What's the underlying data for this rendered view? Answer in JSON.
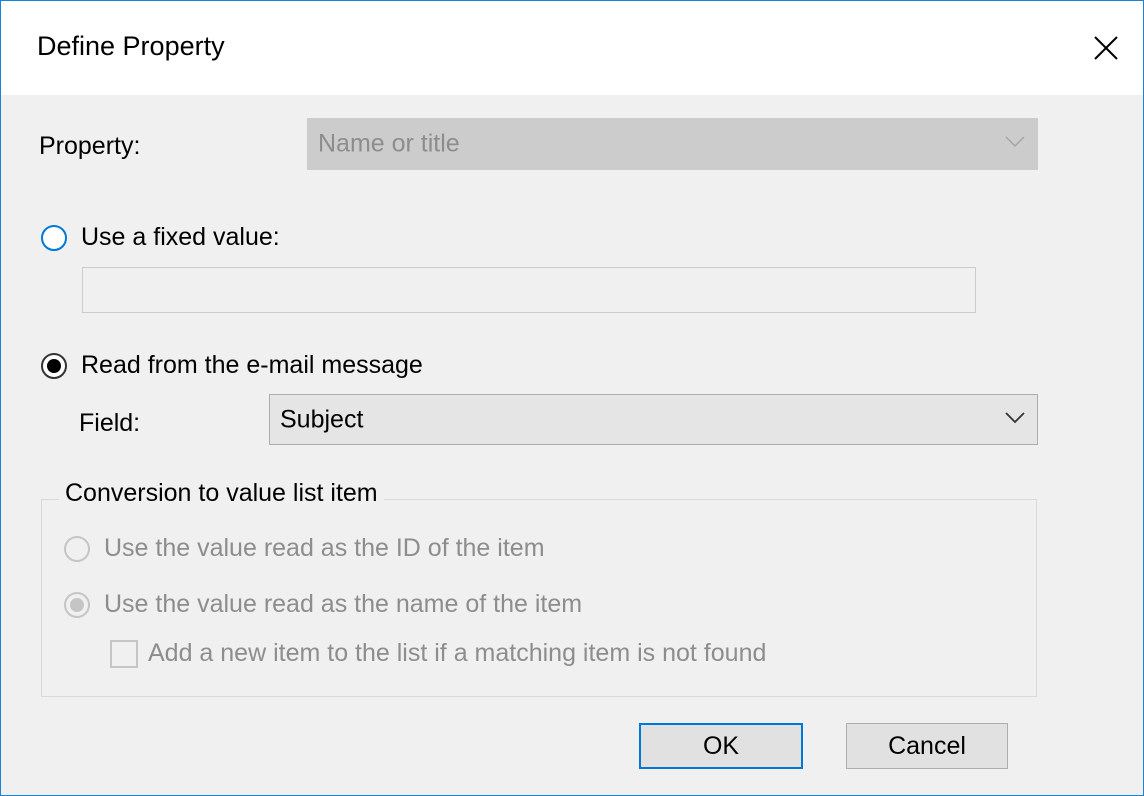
{
  "window": {
    "title": "Define Property",
    "close_icon": "close-icon"
  },
  "property": {
    "label": "Property:",
    "value": "Name or title"
  },
  "fixed_value": {
    "label": "Use a fixed value:",
    "value": "",
    "selected": false
  },
  "read_from_email": {
    "label": "Read from the e-mail message",
    "selected": true
  },
  "field": {
    "label": "Field:",
    "value": "Subject"
  },
  "conversion": {
    "caption": "Conversion to value list item",
    "use_id_label": "Use the value read as the ID of the item",
    "use_name_label": "Use the value read as the name of the item",
    "selected": "use_name",
    "add_new_label": "Add a new item to the list if a matching item is not found",
    "add_new_checked": false
  },
  "buttons": {
    "ok": "OK",
    "cancel": "Cancel"
  },
  "colors": {
    "accent": "#0078d7",
    "window_border": "#1883d7",
    "dialog_bg": "#f0f0f0"
  }
}
